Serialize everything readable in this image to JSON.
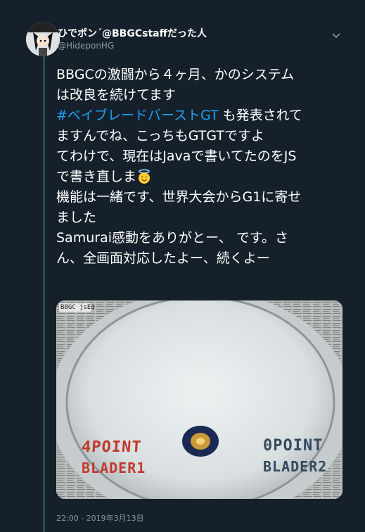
{
  "user": {
    "display_name": "ひでポン´@BBGCstaffだった人",
    "handle": "@HideponHG"
  },
  "tweet": {
    "lines": [
      "BBGCの激闘から４ヶ月、かのシステム",
      "は改良を続けてます",
      "#ベイブレードバーストGT",
      " も発表されて",
      "ますんでね、こっちもGTGTですよ",
      "てわけで、現在はJavaで書いてたのをJS",
      "で書き直しま",
      "機能は一緒です、世界大会からG1に寄せ",
      "ました",
      "Samurai感動をありがとー、 です。さ",
      "ん、全画面対応したよー、続くよー"
    ],
    "emoji_icon": "smiling-face-with-halo",
    "timestamp": "22:00 - 2019年3月13日"
  },
  "media": {
    "label_topleft": "BBGC jsEd",
    "left_score": "4POINT",
    "left_player": "BLADER1",
    "right_score": "0POINT",
    "right_player": "BLADER2"
  },
  "icons": {
    "chevron": "chevron-down-icon"
  },
  "colors": {
    "background": "#15202b",
    "hashtag": "#1da1f2",
    "left_score": "#c0392b",
    "right_score": "#34495e"
  }
}
